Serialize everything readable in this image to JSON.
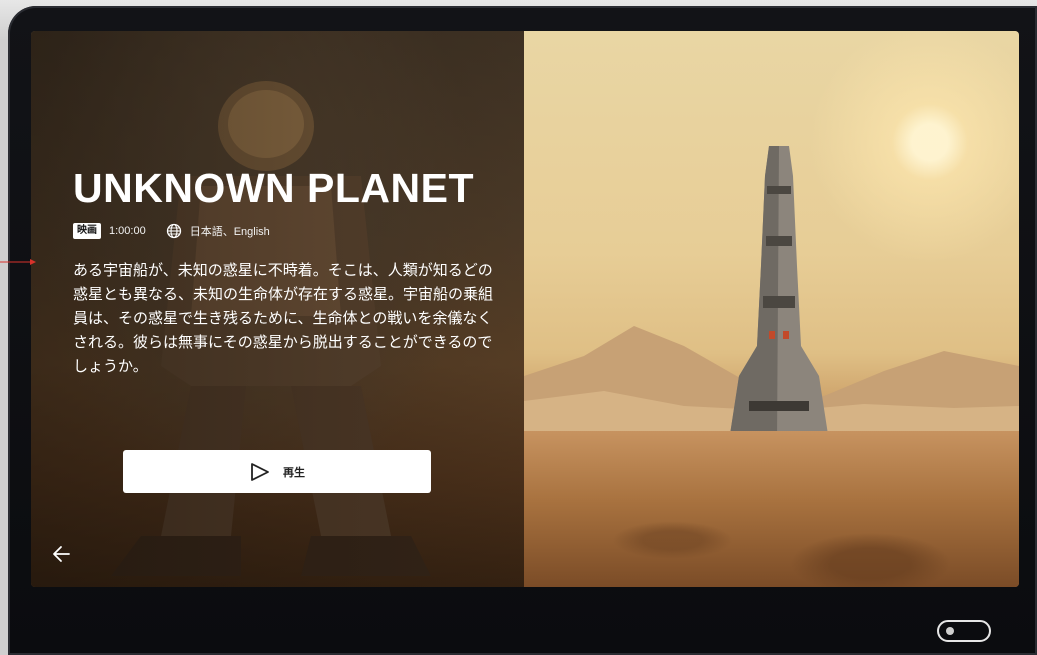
{
  "movie": {
    "title": "UNKNOWN PLANET",
    "badge": "映画",
    "duration": "1:00:00",
    "languages": "日本語、English",
    "description": "ある宇宙船が、未知の惑星に不時着。そこは、人類が知るどの惑星とも異なる、未知の生命体が存在する惑星。宇宙船の乗組員は、その惑星で生き残るために、生命体との戦いを余儀なくされる。彼らは無事にその惑星から脱出することができるのでしょうか。"
  },
  "actions": {
    "play_label": "再生",
    "play_icon": "play-icon",
    "back_icon": "arrow-left-icon"
  },
  "icons": {
    "language": "globe-icon"
  },
  "colors": {
    "button_bg": "#ffffff",
    "title": "#ffffff"
  }
}
